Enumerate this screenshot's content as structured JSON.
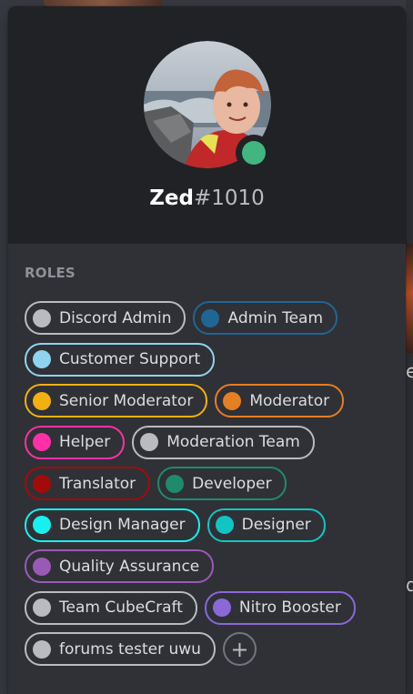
{
  "user": {
    "username": "Zed",
    "discriminator": "#1010",
    "status_color": "#43b581"
  },
  "roles_section": {
    "title": "ROLES",
    "add_symbol": "+"
  },
  "roles": [
    [
      {
        "name": "Discord Admin",
        "color": "#b9bbbe"
      },
      {
        "name": "Admin Team",
        "color": "#206694"
      }
    ],
    [
      {
        "name": "Customer Support",
        "color": "#8fd3f0"
      }
    ],
    [
      {
        "name": "Senior Moderator",
        "color": "#f1b10f"
      },
      {
        "name": "Moderator",
        "color": "#e67e22"
      }
    ],
    [
      {
        "name": "Helper",
        "color": "#ff2fa8"
      },
      {
        "name": "Moderation Team",
        "color": "#b9bbbe"
      }
    ],
    [
      {
        "name": "Translator",
        "color": "#a30b0b"
      },
      {
        "name": "Developer",
        "color": "#1f8b6c"
      }
    ],
    [
      {
        "name": "Design Manager",
        "color": "#18f0f0"
      },
      {
        "name": "Designer",
        "color": "#11c5c5"
      }
    ],
    [
      {
        "name": "Quality Assurance",
        "color": "#9b59b6"
      }
    ],
    [
      {
        "name": "Team CubeCraft",
        "color": "#b9bbbe"
      },
      {
        "name": "Nitro Booster",
        "color": "#8a68d8"
      }
    ],
    [
      {
        "name": "forums tester uwu",
        "color": "#b9bbbe"
      }
    ]
  ],
  "background": {
    "side_chars": [
      "e",
      "d"
    ]
  }
}
